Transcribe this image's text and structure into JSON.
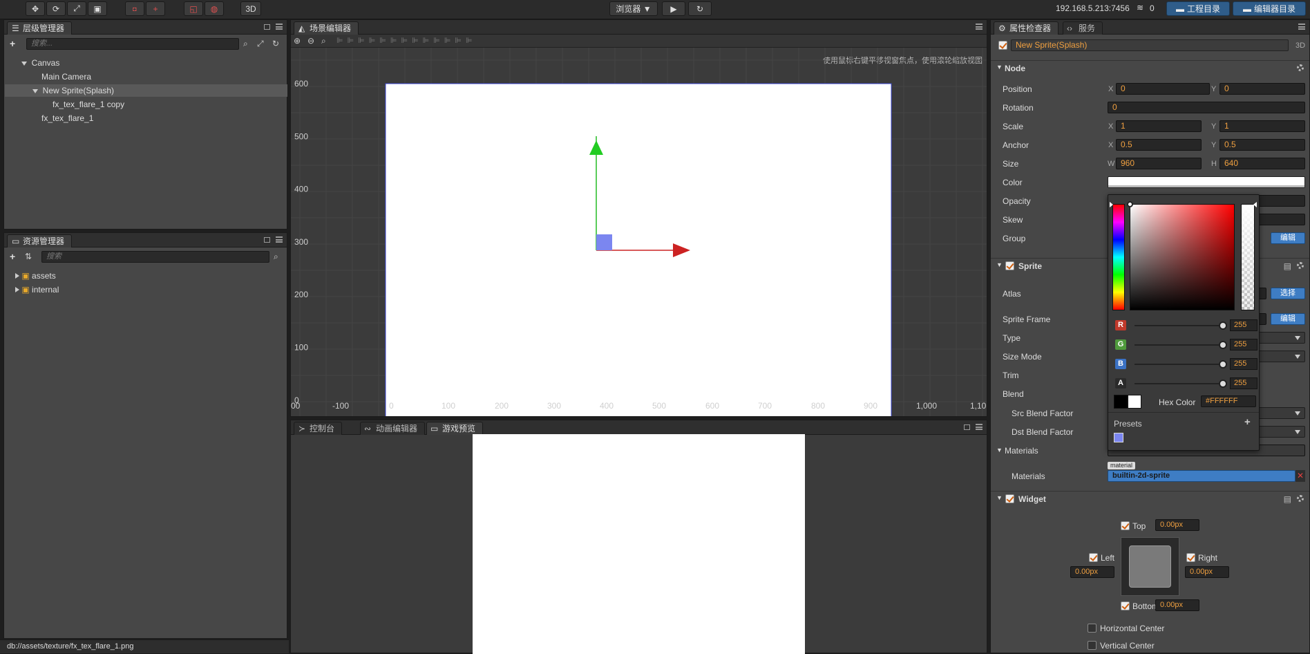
{
  "toolbar": {
    "play_mode_label": "浏览器 ▼",
    "btn_3d": "3D",
    "ip_address": "192.168.5.213:7456",
    "wifi_count": "0",
    "project_dir_label": "工程目录",
    "editor_dir_label": "编辑器目录"
  },
  "hierarchy": {
    "title": "层级管理器",
    "search_placeholder": "搜索...",
    "nodes": [
      {
        "label": "Canvas"
      },
      {
        "label": "Main Camera"
      },
      {
        "label": "New Sprite(Splash)"
      },
      {
        "label": "fx_tex_flare_1 copy"
      },
      {
        "label": "fx_tex_flare_1"
      }
    ]
  },
  "assets": {
    "title": "资源管理器",
    "search_placeholder": "搜索",
    "items": [
      {
        "label": "assets"
      },
      {
        "label": "internal"
      }
    ],
    "status_path": "db://assets/texture/fx_tex_flare_1.png"
  },
  "scene": {
    "title": "场景编辑器",
    "hint": "使用鼠标右键平移视窗焦点，使用滚轮缩放视图",
    "y_ticks": [
      "600",
      "500",
      "400",
      "300",
      "200",
      "100",
      "0"
    ],
    "x_ticks": [
      "00",
      "-100",
      "0",
      "100",
      "200",
      "300",
      "400",
      "500",
      "600",
      "700",
      "800",
      "900",
      "1,000",
      "1,10"
    ]
  },
  "bottom_tabs": [
    {
      "label": "控制台"
    },
    {
      "label": "动画编辑器"
    },
    {
      "label": "游戏预览"
    }
  ],
  "inspector": {
    "tabs": [
      {
        "label": "属性检查器"
      },
      {
        "label": "服务"
      }
    ],
    "node_name": "New Sprite(Splash)",
    "label_3d": "3D",
    "node_section": "Node",
    "position": {
      "label": "Position",
      "x": "0",
      "y": "0"
    },
    "rotation": {
      "label": "Rotation",
      "value": "0"
    },
    "scale": {
      "label": "Scale",
      "x": "1",
      "y": "1"
    },
    "anchor": {
      "label": "Anchor",
      "x": "0.5",
      "y": "0.5"
    },
    "size": {
      "label": "Size",
      "w": "960",
      "h": "640"
    },
    "axis": {
      "x": "X",
      "y": "Y",
      "w": "W",
      "h": "H"
    },
    "color_label": "Color",
    "opacity_label": "Opacity",
    "skew_label": "Skew",
    "group_label": "Group",
    "edit_btn": "编辑",
    "select_btn": "选择",
    "sprite_section": "Sprite",
    "atlas_label": "Atlas",
    "sprite_frame_label": "Sprite Frame",
    "type_label": "Type",
    "size_mode_label": "Size Mode",
    "trim_label": "Trim",
    "blend_label": "Blend",
    "src_blend_label": "Src Blend Factor",
    "dst_blend_label": "Dst Blend Factor",
    "materials_section": "Materials",
    "materials_label": "Materials",
    "material_tag": "material",
    "material_value": "builtin-2d-sprite",
    "widget_section": "Widget",
    "widget": {
      "top_label": "Top",
      "top_value": "0.00px",
      "left_label": "Left",
      "left_value": "0.00px",
      "right_label": "Right",
      "right_value": "0.00px",
      "bottom_label": "Bottom",
      "bottom_value": "0.00px",
      "hcenter_label": "Horizontal Center",
      "vcenter_label": "Vertical Center"
    }
  },
  "color_picker": {
    "r_label": "R",
    "r": "255",
    "g_label": "G",
    "g": "255",
    "b_label": "B",
    "b": "255",
    "a_label": "A",
    "a": "255",
    "hex_label": "Hex Color",
    "hex_value": "#FFFFFF",
    "presets_label": "Presets",
    "preset_color": "#7b86f0"
  },
  "colors": {
    "accent_orange": "#f0a040",
    "button_blue": "#3e7dc4",
    "scene_bg": "#3b3b3b",
    "canvas_fill": "#ffffff"
  }
}
